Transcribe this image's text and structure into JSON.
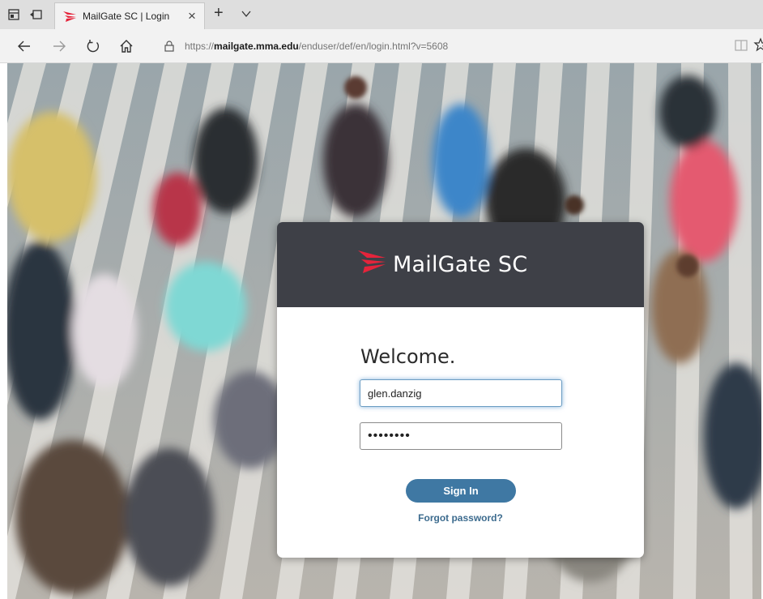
{
  "browser": {
    "tab": {
      "title": "MailGate SC | Login",
      "close_glyph": "×"
    },
    "new_tab_glyph": "+",
    "nav": {
      "back_icon": "arrow-left-icon",
      "forward_icon": "arrow-right-icon",
      "refresh_icon": "refresh-icon",
      "home_icon": "home-icon"
    },
    "address": {
      "scheme": "https://",
      "host": "mailgate.mma.edu",
      "path": "/enduser/def/en/login.html?v=5608"
    }
  },
  "login": {
    "brand": "MailGate SC",
    "welcome": "Welcome.",
    "username_value": "glen.danzig",
    "password_value": "••••••••",
    "sign_in_label": "Sign In",
    "forgot_label": "Forgot password?"
  },
  "colors": {
    "card_header": "#3e4047",
    "accent_red": "#e5243b",
    "button": "#3f78a3",
    "link": "#3c6b8e"
  }
}
